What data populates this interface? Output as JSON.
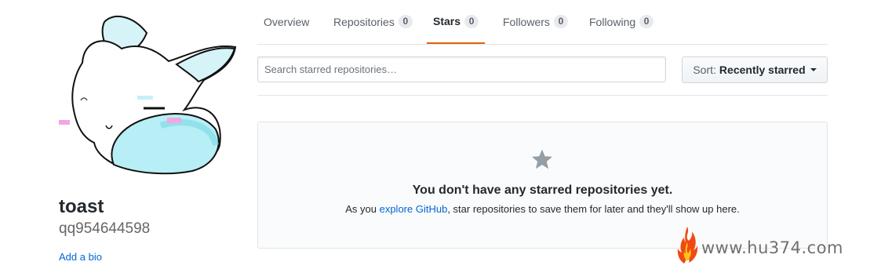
{
  "profile": {
    "display_name": "toast",
    "username": "qq954644598",
    "add_bio_label": "Add a bio"
  },
  "tabs": [
    {
      "label": "Overview",
      "count": null,
      "selected": false
    },
    {
      "label": "Repositories",
      "count": "0",
      "selected": false
    },
    {
      "label": "Stars",
      "count": "0",
      "selected": true
    },
    {
      "label": "Followers",
      "count": "0",
      "selected": false
    },
    {
      "label": "Following",
      "count": "0",
      "selected": false
    }
  ],
  "search": {
    "placeholder": "Search starred repositories…",
    "value": ""
  },
  "sort": {
    "prefix": "Sort:",
    "value": "Recently starred"
  },
  "blankslate": {
    "icon": "star-icon",
    "title": "You don't have any starred repositories yet.",
    "text_before": "As you ",
    "link_text": "explore GitHub",
    "text_after": ", star repositories to save them for later and they'll show up here."
  },
  "watermark": {
    "text": "www.hu374.com"
  },
  "colors": {
    "accent_tab": "#e36209",
    "link": "#0366d6",
    "star_gray": "#959da5",
    "avatar_cyan": "#b8eef5"
  }
}
